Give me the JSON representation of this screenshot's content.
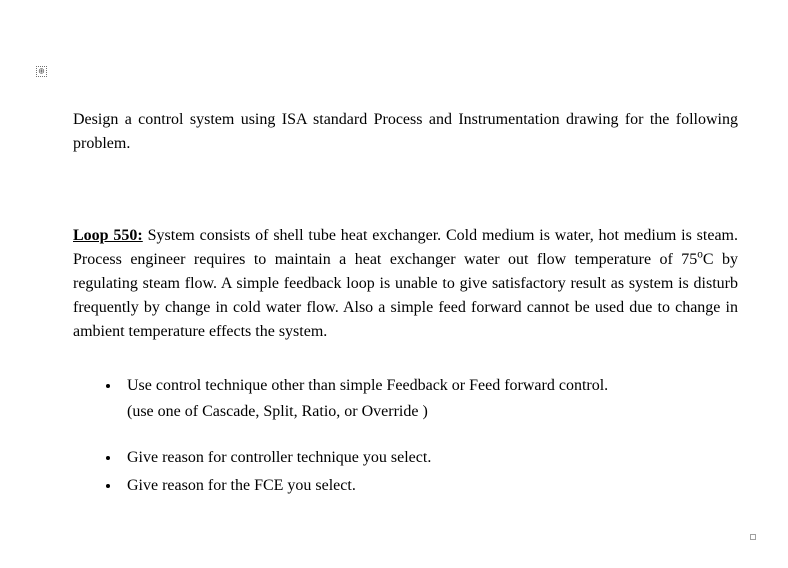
{
  "icons": {
    "anchor_glyph": "⊕"
  },
  "intro": {
    "text": "Design a control system using ISA standard Process and Instrumentation drawing for the following problem."
  },
  "loop": {
    "heading": "Loop 550:",
    "body_before_temp": " System consists of shell tube heat exchanger. Cold medium is water, hot medium is steam. Process engineer requires to maintain a  heat exchanger water out flow temperature of 75",
    "temp_super": "o",
    "body_after_temp": "C by regulating steam flow. A simple feedback loop is unable to give satisfactory result as system is disturb frequently by change in cold water flow. Also a simple feed forward cannot be used due to change in ambient temperature effects the system."
  },
  "bullets": [
    {
      "line1": "Use control technique other than simple Feedback or Feed forward control.",
      "line2": "(use one of Cascade, Split, Ratio, or Override )"
    },
    {
      "line1": "Give reason for controller technique you select."
    },
    {
      "line1": "Give reason for the FCE you select."
    }
  ]
}
